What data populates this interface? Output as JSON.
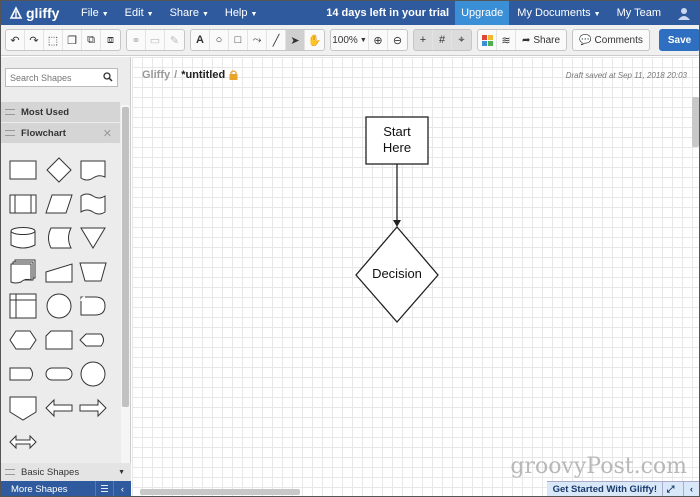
{
  "app": {
    "logo_text": "gliffy",
    "brand_color": "#2f5b9e",
    "accent_color": "#3a8fd6"
  },
  "topnav": {
    "menus": [
      {
        "label": "File"
      },
      {
        "label": "Edit"
      },
      {
        "label": "Share"
      },
      {
        "label": "Help"
      }
    ],
    "trial_text": "14 days left in your trial",
    "upgrade_label": "Upgrade",
    "my_documents_label": "My Documents",
    "my_team_label": "My Team"
  },
  "toolbar": {
    "zoom_value": "100%",
    "share_label": "Share",
    "comments_label": "Comments",
    "save_label": "Save"
  },
  "left_panel": {
    "search_placeholder": "Search Shapes",
    "sections": [
      {
        "label": "Most Used"
      },
      {
        "label": "Flowchart"
      }
    ],
    "bottom_section_label": "Basic Shapes",
    "more_shapes_label": "More Shapes"
  },
  "canvas": {
    "breadcrumb_root": "Gliffy",
    "breadcrumb_sep": "/",
    "document_title": "*untitled",
    "draft_status": "Draft saved at Sep 11, 2018 20:03",
    "diagram": {
      "start_label_line1": "Start",
      "start_label_line2": "Here",
      "decision_label": "Decision"
    },
    "watermark": "groovyPost.com",
    "get_started_label": "Get Started With Gliffy!"
  }
}
